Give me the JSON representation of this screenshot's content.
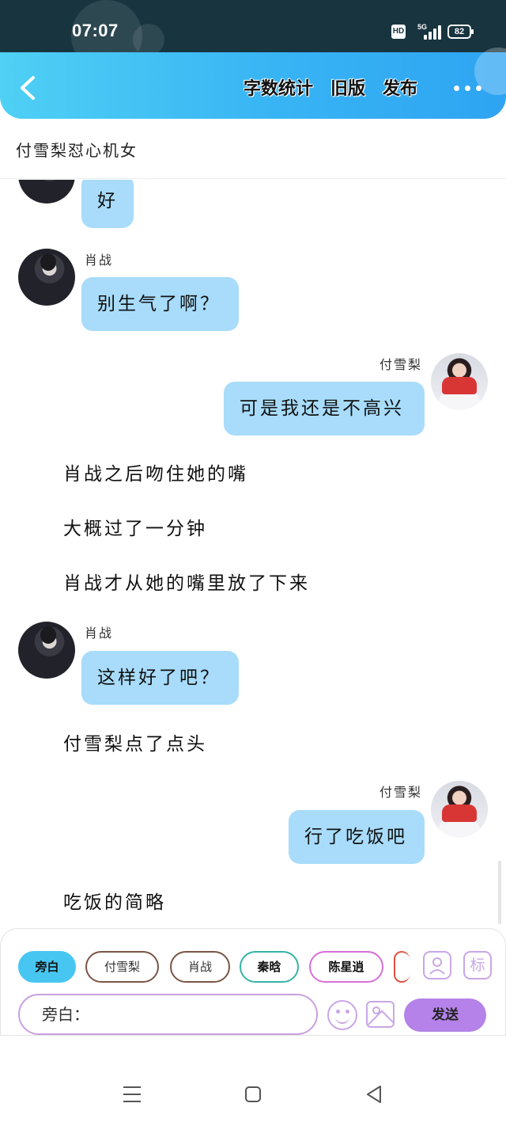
{
  "status_bar": {
    "time": "07:07",
    "hd": "HD",
    "network": "5G",
    "battery": "82"
  },
  "toolbar": {
    "word_count": "字数统计",
    "old_version": "旧版",
    "publish": "发布"
  },
  "title": "付雪梨怼心机女",
  "messages": {
    "m0": {
      "text": "好"
    },
    "m1": {
      "sender": "肖战",
      "text": "别生气了啊？"
    },
    "m2": {
      "sender": "付雪梨",
      "text": "可是我还是不高兴"
    },
    "n1": {
      "text": "肖战之后吻住她的嘴"
    },
    "n2": {
      "text": "大概过了一分钟"
    },
    "n3": {
      "text": "肖战才从她的嘴里放了下来"
    },
    "m3": {
      "sender": "肖战",
      "text": "这样好了吧？"
    },
    "n4": {
      "text": "付雪梨点了点头"
    },
    "m4": {
      "sender": "付雪梨",
      "text": "行了吃饭吧"
    },
    "n5": {
      "text": "吃饭的简略"
    }
  },
  "roles": {
    "narrator": "旁白",
    "fu": "付雪梨",
    "xiao": "肖战",
    "qin": "秦晗",
    "chen": "陈星逍"
  },
  "input": {
    "value": "旁白："
  },
  "icons": {
    "mark": "标"
  },
  "send": "发送",
  "colors": {
    "bubble": "#a8dcfa",
    "header": "#38b4f4",
    "send": "#b482e8",
    "active_role": "#48c6f2"
  }
}
